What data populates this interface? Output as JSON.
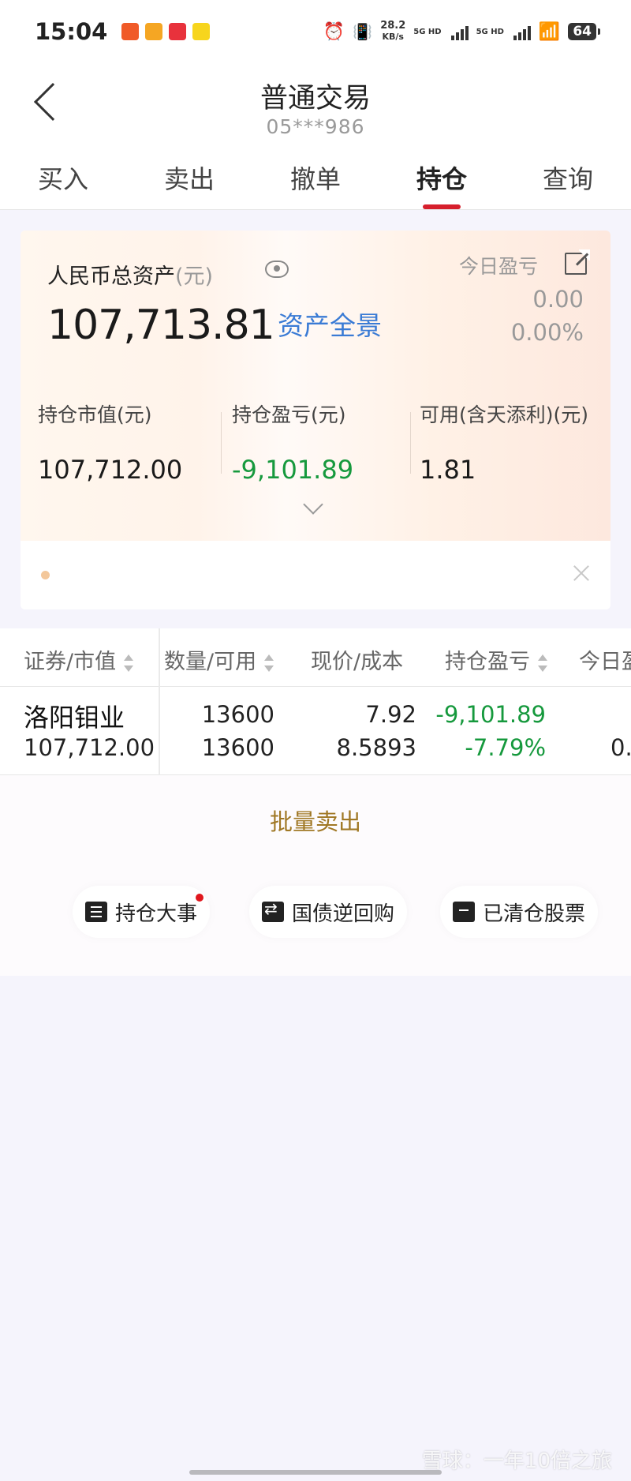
{
  "status_bar": {
    "time": "15:04",
    "net_speed": "28.2",
    "net_speed_unit": "KB/s",
    "sim1": "5G HD",
    "sim2": "5G HD",
    "battery": "64"
  },
  "header": {
    "title": "普通交易",
    "account": "05***986"
  },
  "tabs": [
    {
      "label": "买入",
      "active": false
    },
    {
      "label": "卖出",
      "active": false
    },
    {
      "label": "撤单",
      "active": false
    },
    {
      "label": "持仓",
      "active": true
    },
    {
      "label": "查询",
      "active": false
    }
  ],
  "summary": {
    "total_label": "人民币总资产",
    "total_unit": "(元)",
    "total_value": "107,713.81",
    "asset_link": "资产全景",
    "today_label": "今日盈亏",
    "today_value": "0.00",
    "today_pct": "0.00%",
    "metrics": [
      {
        "label": "持仓市值(元)",
        "value": "107,712.00"
      },
      {
        "label": "持仓盈亏(元)",
        "value": "-9,101.89"
      },
      {
        "label": "可用(含天添利)(元)",
        "value": "1.81"
      }
    ]
  },
  "table": {
    "columns": [
      "证券/市值",
      "数量/可用",
      "现价/成本",
      "持仓盈亏",
      "今日盈"
    ],
    "rows": [
      {
        "name": "洛阳钼业",
        "market_value": "107,712.00",
        "quantity": "13600",
        "available": "13600",
        "price": "7.92",
        "cost": "8.5893",
        "pnl": "-9,101.89",
        "pnl_pct": "-7.79%",
        "today_partial": "0."
      }
    ]
  },
  "actions": {
    "batch_sell": "批量卖出",
    "shortcuts": [
      "持仓大事",
      "国债逆回购",
      "已清仓股票"
    ]
  },
  "watermark": "雪球：一年10倍之旅",
  "colors": {
    "accent_red": "#d61f2c",
    "loss_green": "#16993d",
    "link_blue": "#3a7bd5",
    "batch_gold": "#a07825"
  }
}
